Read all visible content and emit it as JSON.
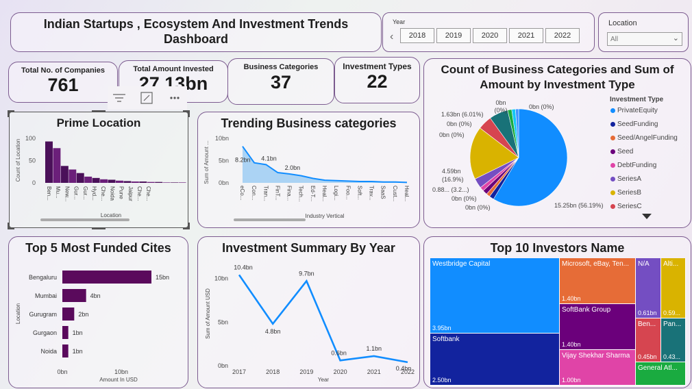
{
  "header": {
    "title_line1": "Indian Startups , Ecosystem And Investment Trends",
    "title_line2": "Dashboard"
  },
  "year_filter": {
    "label": "Year",
    "years": [
      "2018",
      "2019",
      "2020",
      "2021",
      "2022"
    ]
  },
  "location_filter": {
    "label": "Location",
    "value": "All"
  },
  "kpis": [
    {
      "label": "Total No. of Companies",
      "value": "761"
    },
    {
      "label": "Total Amount Invested",
      "value": "27.13bn"
    },
    {
      "label": "Business Categories",
      "value": "37"
    },
    {
      "label": "Investment Types",
      "value": "22"
    }
  ],
  "toolbar_icons": [
    "filter-icon",
    "focus-mode-icon",
    "more-options-icon"
  ],
  "prime_location": {
    "title": "Prime Location",
    "ylabel": "Count of Location",
    "xlabel": "Location",
    "yticks": [
      "100",
      "50",
      "0"
    ],
    "categories": [
      "Ben...",
      "Mu...",
      "New...",
      "Gur...",
      "Gur...",
      "Hyd...",
      "Che...",
      "Noida",
      "Pune",
      "Jaipur",
      "Che...",
      "Che..."
    ],
    "values": [
      93,
      78,
      38,
      30,
      22,
      14,
      11,
      8,
      7,
      5,
      4,
      3,
      3,
      2,
      2,
      1,
      1,
      1
    ]
  },
  "trending": {
    "title": "Trending Business categories",
    "ylabel": "Sum of Amount ...",
    "xlabel": "Industry Vertical",
    "yticks": [
      "10bn",
      "5bn",
      "0bn"
    ],
    "categories": [
      "eCo...",
      "Con...",
      "Tran...",
      "FinT...",
      "Fina...",
      "Tech...",
      "Ed-T...",
      "Heal...",
      "Logi...",
      "Foo...",
      "Soft...",
      "Trav...",
      "SaaS",
      "Cust...",
      "Heal..."
    ],
    "values": [
      8.2,
      4.5,
      4.1,
      2.3,
      2.0,
      1.6,
      1.0,
      0.6,
      0.5,
      0.4,
      0.3,
      0.3,
      0.2,
      0.2,
      0.1
    ],
    "labels": [
      "8.2bn",
      "4.1bn",
      "2.0bn"
    ]
  },
  "pie": {
    "title_line1": "Count of Business Categories and Sum of",
    "title_line2": "Amount by Investment Type",
    "legend_title": "Investment Type",
    "legend": [
      {
        "name": "PrivateEquity",
        "color": "#118dff"
      },
      {
        "name": "SeedFunding",
        "color": "#12239e"
      },
      {
        "name": "Seed/AngelFunding",
        "color": "#e66c37"
      },
      {
        "name": "Seed",
        "color": "#6b007b"
      },
      {
        "name": "DebtFunding",
        "color": "#e044a7"
      },
      {
        "name": "SeriesA",
        "color": "#744ec2"
      },
      {
        "name": "SeriesB",
        "color": "#d9b300"
      },
      {
        "name": "SeriesC",
        "color": "#d64550"
      }
    ],
    "labels": [
      "0bn",
      "(0%)",
      "0bn (0%)",
      "1.63bn (6.01%)",
      "0bn (0%)",
      "0bn (0%)",
      "4.59bn",
      "(16.9%)",
      "0.88... (3.2...)",
      "0bn (0%)",
      "0bn (0%)",
      "15.25bn (56.19%)"
    ]
  },
  "chart_data": [
    {
      "type": "bar",
      "title": "Top 5 Most Funded Cites",
      "categories": [
        "Bengaluru",
        "Mumbai",
        "Gurugram",
        "Gurgaon",
        "Noida"
      ],
      "values": [
        15,
        4,
        2,
        1,
        1
      ],
      "data_labels": [
        "15bn",
        "4bn",
        "2bn",
        "1bn",
        "1bn"
      ],
      "xticks": [
        "0bn",
        "10bn"
      ],
      "xlabel": "Amount In USD",
      "ylabel": "Location",
      "xlim": [
        0,
        20
      ],
      "color": "#5a0a5c"
    },
    {
      "type": "line",
      "title": "Investment Summary By Year",
      "x": [
        "2017",
        "2018",
        "2019",
        "2020",
        "2021",
        "2022"
      ],
      "values": [
        10.4,
        4.8,
        9.7,
        0.6,
        1.1,
        0.4
      ],
      "data_labels": [
        "10.4bn",
        "4.8bn",
        "9.7bn",
        "0.6bn",
        "1.1bn",
        "0.4bn"
      ],
      "yticks": [
        "10bn",
        "5bn",
        "0bn"
      ],
      "xlabel": "Year",
      "ylabel": "Sum of Amount USD",
      "ylim": [
        0,
        12
      ],
      "color": "#118dff"
    }
  ],
  "treemap": {
    "title": "Top 10 Investors Name",
    "items": [
      {
        "name": "Westbridge Capital",
        "value": "3.95bn",
        "color": "#118dff"
      },
      {
        "name": "Softbank",
        "value": "2.50bn",
        "color": "#12239e"
      },
      {
        "name": "Microsoft, eBay, Ten...",
        "value": "1.40bn",
        "color": "#e66c37"
      },
      {
        "name": "SoftBank Group",
        "value": "1.40bn",
        "color": "#6b007b"
      },
      {
        "name": "Vijay Shekhar Sharma",
        "value": "1.00bn",
        "color": "#e044a7"
      },
      {
        "name": "N/A",
        "value": "0.61bn",
        "color": "#744ec2"
      },
      {
        "name": "Alti...",
        "value": "0.59...",
        "color": "#d9b300"
      },
      {
        "name": "Ben...",
        "value": "0.45bn",
        "color": "#d64550"
      },
      {
        "name": "Pan...",
        "value": "0.43...",
        "color": "#197278"
      },
      {
        "name": "General Atl...",
        "value": "",
        "color": "#1aab40"
      }
    ]
  }
}
